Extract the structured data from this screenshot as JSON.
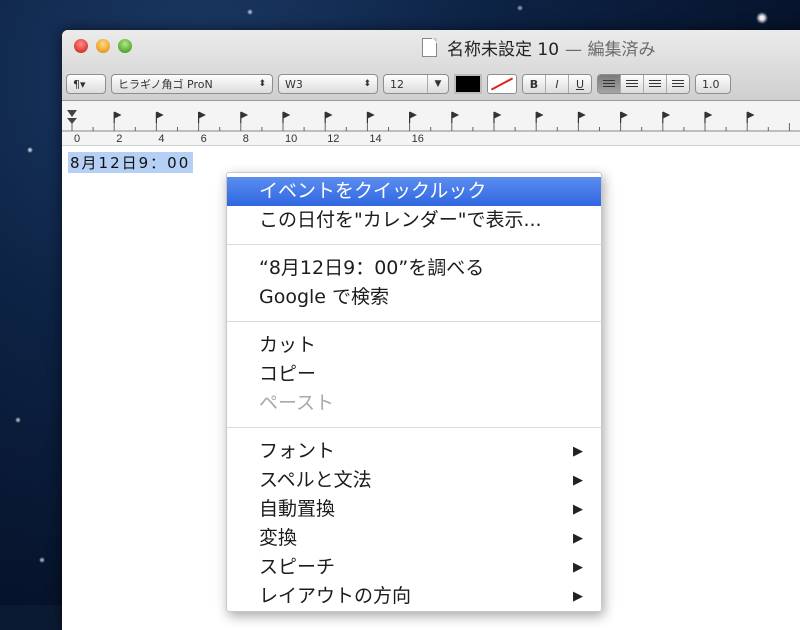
{
  "window": {
    "title": "名称未設定 10",
    "status": "— 編集済み"
  },
  "toolbar": {
    "paragraph": "¶▾",
    "font_family": "ヒラギノ角ゴ ProN",
    "font_weight": "W3",
    "font_size": "12",
    "bold": "B",
    "italic": "I",
    "underline": "U",
    "spacing": "1.0",
    "text_color": "#000000"
  },
  "ruler": {
    "labels": [
      "0",
      "2",
      "4",
      "6",
      "8",
      "10",
      "12",
      "14",
      "16"
    ]
  },
  "document": {
    "selected_text": "8月12日9：00"
  },
  "context_menu": {
    "groups": [
      [
        {
          "label": "イベントをクイックルック",
          "highlighted": true
        },
        {
          "label": "この日付を\"カレンダー\"で表示..."
        }
      ],
      [
        {
          "label": "“8月12日9：00”を調べる"
        },
        {
          "label": "Google で検索"
        }
      ],
      [
        {
          "label": "カット"
        },
        {
          "label": "コピー"
        },
        {
          "label": "ペースト",
          "disabled": true
        }
      ],
      [
        {
          "label": "フォント",
          "submenu": true
        },
        {
          "label": "スペルと文法",
          "submenu": true
        },
        {
          "label": "自動置換",
          "submenu": true
        },
        {
          "label": "変換",
          "submenu": true
        },
        {
          "label": "スピーチ",
          "submenu": true
        },
        {
          "label": "レイアウトの方向",
          "submenu": true
        }
      ]
    ],
    "submenu_arrow": "▶"
  }
}
